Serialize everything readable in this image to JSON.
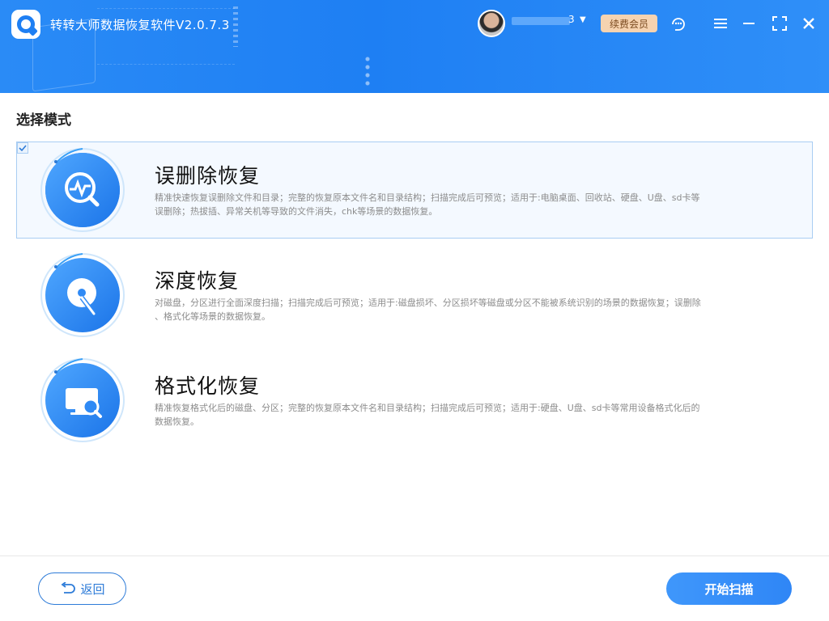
{
  "header": {
    "app_title": "转转大师数据恢复软件V2.0.7.3",
    "username_tail": "3",
    "vip_label": "续费会员",
    "icons": [
      "logo-icon",
      "avatar",
      "chevron-down-icon",
      "customer-service-icon",
      "menu-icon",
      "minimize-icon",
      "maximize-icon",
      "close-icon"
    ]
  },
  "section": {
    "title": "选择模式"
  },
  "modes": [
    {
      "name": "误删除恢复",
      "desc_line1": "精准快速恢复误删除文件和目录；完整的恢复原本文件名和目录结构；扫描完成后可预览；适用于:电脑桌面、回收站、硬盘、U盘、sd卡等",
      "desc_line2": "误删除；热拔插、异常关机等导致的文件消失，chk等场景的数据恢复。",
      "selected": true,
      "icon": "waveform-search-icon"
    },
    {
      "name": "深度恢复",
      "desc_line1": "对磁盘，分区进行全面深度扫描；扫描完成后可预览；适用于:磁盘损坏、分区损坏等磁盘或分区不能被系统识别的场景的数据恢复；误删除",
      "desc_line2": "、格式化等场景的数据恢复。",
      "selected": false,
      "icon": "disk-scan-icon"
    },
    {
      "name": "格式化恢复",
      "desc_line1": "精准恢复格式化后的磁盘、分区；完整的恢复原本文件名和目录结构；扫描完成后可预览；适用于:硬盘、U盘、sd卡等常用设备格式化后的",
      "desc_line2": "数据恢复。",
      "selected": false,
      "icon": "monitor-search-icon"
    }
  ],
  "footer": {
    "back_label": "返回",
    "start_label": "开始扫描"
  },
  "colors": {
    "header_blue": "#1e7ff3",
    "accent_blue": "#2f86f6",
    "vip_bg": "#f6d3b0",
    "selected_border": "#a9cdf3"
  }
}
